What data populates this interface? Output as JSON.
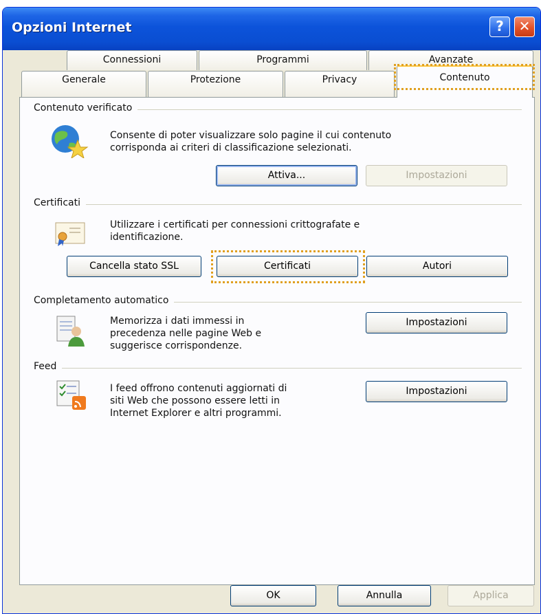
{
  "window": {
    "title": "Opzioni Internet",
    "help": "?",
    "close": "✕"
  },
  "tabs": {
    "row1": [
      "Connessioni",
      "Programmi",
      "Avanzate"
    ],
    "row2": [
      "Generale",
      "Protezione",
      "Privacy",
      "Contenuto"
    ],
    "active": "Contenuto"
  },
  "content_advisor": {
    "label": "Contenuto verificato",
    "description_line1": "Consente di poter visualizzare solo pagine il cui contenuto",
    "description_line2": "corrisponda ai criteri di classificazione selezionati.",
    "enable_button": "Attiva...",
    "settings_button": "Impostazioni"
  },
  "certificates": {
    "label": "Certificati",
    "description_line1": "Utilizzare i certificati per connessioni crittografate e",
    "description_line2": "identificazione.",
    "clear_ssl_button": "Cancella stato SSL",
    "certificates_button": "Certificati",
    "publishers_button": "Autori"
  },
  "autocomplete": {
    "label": "Completamento automatico",
    "description_line1": "Memorizza i dati immessi in",
    "description_line2": "precedenza nelle pagine Web e",
    "description_line3": "suggerisce corrispondenze.",
    "settings_button": "Impostazioni"
  },
  "feeds": {
    "label": "Feed",
    "description_line1": "I feed offrono contenuti aggiornati di",
    "description_line2": "siti Web che possono essere letti in",
    "description_line3": "Internet Explorer e altri programmi.",
    "settings_button": "Impostazioni"
  },
  "footer": {
    "ok": "OK",
    "cancel": "Annulla",
    "apply": "Applica"
  },
  "colors": {
    "titlebar": "#0a4ed2",
    "highlight": "#e0a020",
    "window_bg": "#ece9d8"
  }
}
